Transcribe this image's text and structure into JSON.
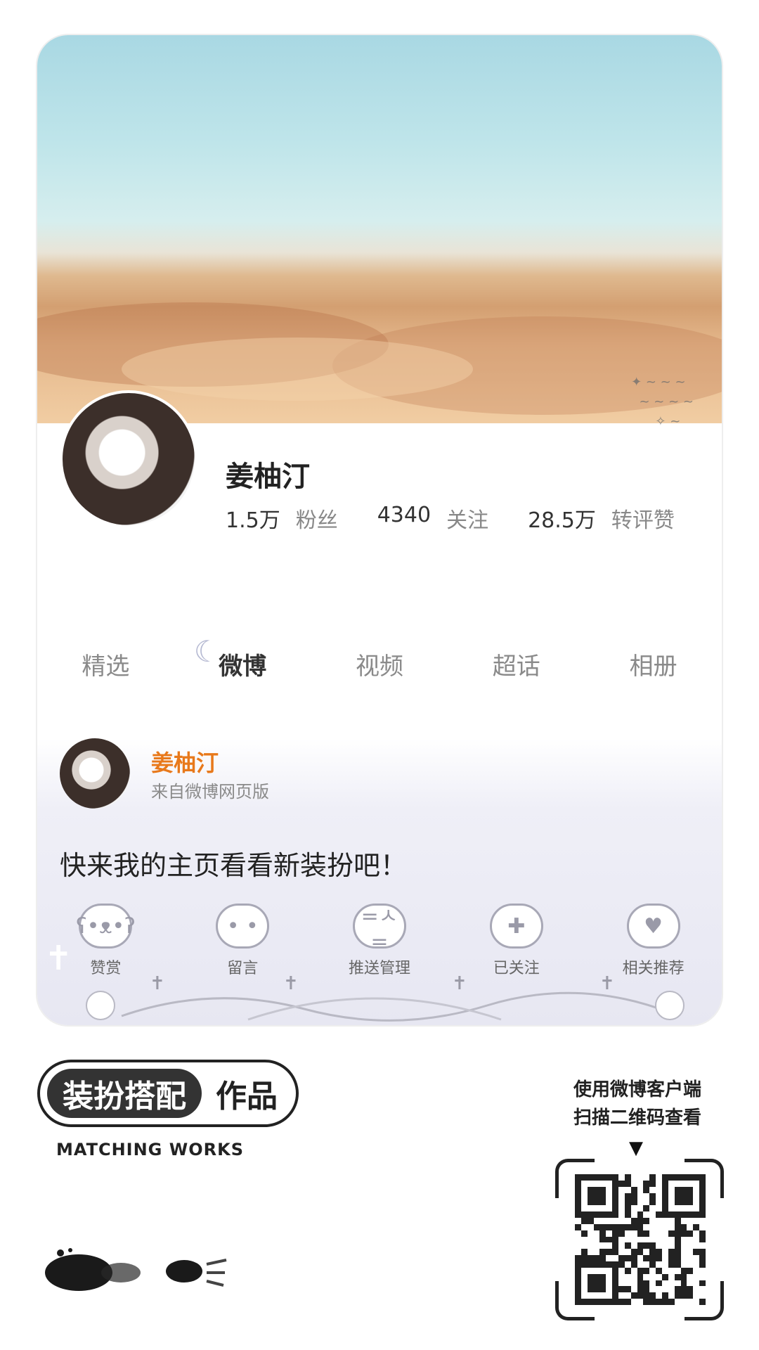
{
  "profile": {
    "name": "姜柚汀",
    "stats": [
      {
        "value": "1.5万",
        "label": "粉丝"
      },
      {
        "value": "4340",
        "label": "关注"
      },
      {
        "value": "28.5万",
        "label": "转评赞"
      }
    ]
  },
  "tabs": [
    {
      "label": "精选",
      "active": false
    },
    {
      "label": "微博",
      "active": true
    },
    {
      "label": "视频",
      "active": false
    },
    {
      "label": "超话",
      "active": false
    },
    {
      "label": "相册",
      "active": false
    }
  ],
  "post": {
    "author": "姜柚汀",
    "source": "来自微博网页版",
    "text": "快来我的主页看看新装扮吧！"
  },
  "actions": [
    {
      "label": "赞赏",
      "icon": "angel-bear-icon"
    },
    {
      "label": "留言",
      "icon": "ghost-icon"
    },
    {
      "label": "推送管理",
      "icon": "cat-icon"
    },
    {
      "label": "已关注",
      "icon": "cross-icon"
    },
    {
      "label": "相关推荐",
      "icon": "heart-icon"
    }
  ],
  "footer": {
    "badge_dark": "装扮搭配",
    "badge_light": "作品",
    "subtitle": "MATCHING WORKS",
    "qr_caption_line1": "使用微博客户端",
    "qr_caption_line2": "扫描二维码查看"
  }
}
